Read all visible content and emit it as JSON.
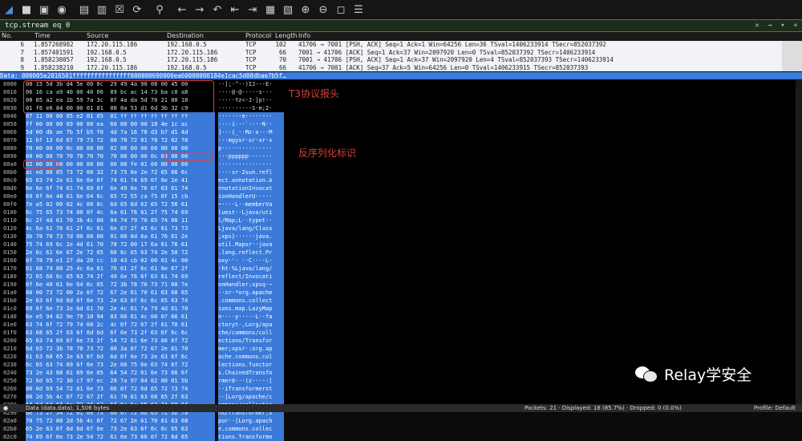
{
  "toolbar": {
    "icons": [
      "shark-fin-icon",
      "stop-icon",
      "restart-icon",
      "options-gear-icon",
      "open-file-icon",
      "save-file-icon",
      "close-file-icon",
      "reload-icon",
      "search-icon",
      "back-arrow-icon",
      "forward-arrow-icon",
      "go-to-packet-icon",
      "first-packet-icon",
      "last-packet-icon",
      "autoscroll-icon",
      "colorize-icon",
      "zoom-in-icon",
      "zoom-out-icon",
      "normal-size-icon",
      "resize-columns-icon"
    ]
  },
  "filter": {
    "value": "tcp.stream eq 0"
  },
  "columns": [
    "No.",
    "Time",
    "Source",
    "Destination",
    "Protocol",
    "Length",
    "Info"
  ],
  "packets": [
    {
      "no": "6",
      "time": "1.857268982",
      "src": "172.20.115.186",
      "dst": "192.168.0.5",
      "proto": "TCP",
      "len": "102",
      "info": "41706 → 7001 [PSH, ACK] Seq=1 Ack=1 Win=64256 Len=36 TSval=1406233914 TSecr=852037392"
    },
    {
      "no": "7",
      "time": "1.857401591",
      "src": "192.168.0.5",
      "dst": "172.20.115.186",
      "proto": "TCP",
      "len": "66",
      "info": "7001 → 41706 [ACK] Seq=1 Ack=37 Win=2097920 Len=0 TSval=852037392 TSecr=1406233914"
    },
    {
      "no": "8",
      "time": "1.858230057",
      "src": "192.168.0.5",
      "dst": "172.20.115.186",
      "proto": "TCP",
      "len": "70",
      "info": "7001 → 41706 [PSH, ACK] Seq=1 Ack=37 Win=2097920 Len=4 TSval=852037393 TSecr=1406233914"
    },
    {
      "no": "9",
      "time": "1.858238210",
      "src": "172.20.115.186",
      "dst": "192.168.0.5",
      "proto": "TCP",
      "len": "66",
      "info": "41706 → 7001 [ACK] Seq=37 Ack=5 Win=64256 Len=0 TSval=1406233915 TSecr=852037393"
    }
  ],
  "data_bar": "Data: 000005e2016501ffffffffffffffff000000690000ea60000000184e1cac5d00dbae7b5f…",
  "annotations": {
    "t3_header": "T3协议报头",
    "deserialize_marker": "反序列化标识"
  },
  "hex_rows": [
    {
      "o": "0000",
      "h": "00 15 5d 3b d4 5e 00 0c  29 49 4a 90 08 00 45 00",
      "a": "··];·^··)IJ···E·",
      "s": false
    },
    {
      "o": "0010",
      "h": "06 16 ca a9 40 00 40 06  89 bc ac 14 73 ba c0 a8",
      "a": "····@·@·····s···",
      "s": false
    },
    {
      "o": "0020",
      "h": "00 05 a2 ea 1b 59 7a 3c  8f 4a da 5d 70 21 80 18",
      "a": "·····Yz<·J·]p!··",
      "s": false
    },
    {
      "o": "0030",
      "h": "01 f6 e6 84 00 00 01 01  08 0a 53 d1 6d 3b 32 c9",
      "a": "··········S·m;2·",
      "s": false
    },
    {
      "o": "0040",
      "h": "07 11 00 00 05 e2 01 65  01 ff ff ff ff ff ff ff",
      "a": "·······e········",
      "s": true
    },
    {
      "o": "0050",
      "h": "ff 00 00 00 69 00 00 ea  60 00 00 00 18 4e 1c ac",
      "a": "····i···`····N··",
      "s": true
    },
    {
      "o": "0060",
      "h": "5d 00 db ae 7b 5f b5 f0  4d 7a 16 78 d3 b7 d1 4d",
      "a": "]···{_··Mz·x···M",
      "s": true
    },
    {
      "o": "0070",
      "h": "11 bf 13 6d 67 79 73 72  00 78 72 01 78 72 02 78",
      "a": "···mgysr·xr·xr·x",
      "s": true
    },
    {
      "o": "0080",
      "h": "70 00 00 00 0c 00 00 00  02 00 00 00 00 00 00 00",
      "a": "p···············",
      "s": true
    },
    {
      "o": "0090",
      "h": "00 00 00 70 70 70 70 70  70 00 00 00 0c 00 00 00",
      "a": "···pppppp·······",
      "s": true
    },
    {
      "o": "00a0",
      "h": "02 00 00 00 00 00 00 00  06 00 fe 01 00 00 00 00",
      "a": "················",
      "s": true
    },
    {
      "o": "00b0",
      "h": "ac ed 00 05 73 72 00 32  73 75 6e 2e 72 65 66 6c",
      "a": "····sr·2sun.refl",
      "s": true
    },
    {
      "o": "00c0",
      "h": "65 63 74 2e 61 6e 6e 6f  74 61 74 69 6f 6e 2e 41",
      "a": "ect.annotation.A",
      "s": true
    },
    {
      "o": "00d0",
      "h": "6e 6e 6f 74 61 74 69 6f  6e 49 6e 76 6f 63 61 74",
      "a": "nnotationInvocat",
      "s": true
    },
    {
      "o": "00e0",
      "h": "69 6f 6e 48 61 6e 64 6c  65 72 55 ca f5 0f 15 cb",
      "a": "ionHandlerU·····",
      "s": true
    },
    {
      "o": "00f0",
      "h": "7e a5 02 00 02 4c 00 0c  6d 65 6d 62 65 72 56 61",
      "a": "~····L··memberVa",
      "s": true
    },
    {
      "o": "0100",
      "h": "6c 75 65 73 74 00 0f 4c  6a 61 76 61 2f 75 74 69",
      "a": "luest··Ljava/uti",
      "s": true
    },
    {
      "o": "0110",
      "h": "6c 2f 4d 61 70 3b 4c 00  04 74 79 70 65 74 00 11",
      "a": "l/Map;L··typet··",
      "s": true
    },
    {
      "o": "0120",
      "h": "4c 6a 61 76 61 2f 6c 61  6e 67 2f 43 6c 61 73 73",
      "a": "Ljava/lang/Class",
      "s": true
    },
    {
      "o": "0130",
      "h": "3b 78 70 73 7d 00 00 00  01 00 0d 6a 61 76 61 2e",
      "a": ";xps}······java.",
      "s": true
    },
    {
      "o": "0140",
      "h": "75 74 69 6c 2e 4d 61 70  78 72 00 17 6a 61 76 61",
      "a": "util.Mapxr··java",
      "s": true
    },
    {
      "o": "0150",
      "h": "2e 6c 61 6e 67 2e 72 65  66 6c 65 63 74 2e 50 72",
      "a": ".lang.reflect.Pr",
      "s": true
    },
    {
      "o": "0160",
      "h": "6f 78 79 e1 27 da 20 cc  10 43 cb 02 00 01 4c 00",
      "a": "oxy·'· ··C····L·",
      "s": true
    },
    {
      "o": "0170",
      "h": "01 68 74 00 25 4c 6a 61  76 61 2f 6c 61 6e 67 2f",
      "a": "·ht·%Ljava/lang/",
      "s": true
    },
    {
      "o": "0180",
      "h": "72 65 66 6c 65 63 74 2f  49 6e 76 6f 63 61 74 69",
      "a": "reflect/Invocati",
      "s": true
    },
    {
      "o": "0190",
      "h": "6f 6e 48 61 6e 64 6c 65  72 3b 78 70 73 71 00 7e",
      "a": "onHandler;xpsq·~",
      "s": true
    },
    {
      "o": "01a0",
      "h": "00 00 73 72 00 2a 6f 72  67 2e 61 70 61 63 68 65",
      "a": "··sr·*org.apache",
      "s": true
    },
    {
      "o": "01b0",
      "h": "2e 63 6f 6d 6d 6f 6e 73  2e 63 6f 6c 6c 65 63 74",
      "a": ".commons.collect",
      "s": true
    },
    {
      "o": "01c0",
      "h": "69 6f 6e 73 2e 6d 61 70  2e 4c 61 7a 79 4d 61 70",
      "a": "ions.map.LazyMap",
      "s": true
    },
    {
      "o": "01d0",
      "h": "6e e5 94 82 9e 79 10 94  03 00 01 4c 00 07 66 61",
      "a": "n····y·····L··fa",
      "s": true
    },
    {
      "o": "01e0",
      "h": "63 74 6f 72 79 74 00 2c  4c 6f 72 67 2f 61 70 61",
      "a": "ctoryt·,Lorg/apa",
      "s": true
    },
    {
      "o": "01f0",
      "h": "63 68 65 2f 63 6f 6d 6d  6f 6e 73 2f 63 6f 6c 6c",
      "a": "che/commons/coll",
      "s": true
    },
    {
      "o": "0200",
      "h": "65 63 74 69 6f 6e 73 2f  54 72 61 6e 73 66 6f 72",
      "a": "ections/Transfor",
      "s": true
    },
    {
      "o": "0210",
      "h": "6d 65 72 3b 78 70 73 72  00 3a 6f 72 67 2e 61 70",
      "a": "mer;xpsr·:org.ap",
      "s": true
    },
    {
      "o": "0220",
      "h": "61 63 68 65 2e 63 6f 6d  6d 6f 6e 73 2e 63 6f 6c",
      "a": "ache.commons.col",
      "s": true
    },
    {
      "o": "0230",
      "h": "6c 65 63 74 69 6f 6e 73  2e 66 75 6e 63 74 6f 72",
      "a": "lections.functor",
      "s": true
    },
    {
      "o": "0240",
      "h": "73 2e 43 68 61 69 6e 65  64 54 72 61 6e 73 66 6f",
      "a": "s.ChainedTransfo",
      "s": true
    },
    {
      "o": "0250",
      "h": "72 6d 65 72 30 c7 97 ec  28 7a 97 04 02 00 01 5b",
      "a": "rmer0···(z·····[",
      "s": true
    },
    {
      "o": "0260",
      "h": "00 0d 69 54 72 61 6e 73  66 6f 72 6d 65 72 73 74",
      "a": "··iTransformerst",
      "s": true
    },
    {
      "o": "0270",
      "h": "00 2d 5b 4c 6f 72 67 2f  61 70 61 63 68 65 2f 63",
      "a": "·-[Lorg/apache/c",
      "s": true
    },
    {
      "o": "0280",
      "h": "6f 6d 6d 6f 6e 73 2f 63  6f 6c 6c 65 63 74 69 6f",
      "a": "ommons/collectio",
      "s": true
    },
    {
      "o": "0290",
      "h": "6e 73 2f 54 72 61 6e 73  66 6f 72 6d 65 72 3b 78",
      "a": "ns/Transformer;x",
      "s": true
    },
    {
      "o": "02a0",
      "h": "70 75 72 00 2d 5b 4c 6f  72 67 2e 61 70 61 63 68",
      "a": "pur·-[Lorg.apach",
      "s": true
    },
    {
      "o": "02b0",
      "h": "65 2e 63 6f 6d 6d 6f 6e  73 2e 63 6f 6c 6c 65 63",
      "a": "e.commons.collec",
      "s": true
    },
    {
      "o": "02c0",
      "h": "74 69 6f 6e 73 2e 54 72  61 6e 73 66 6f 72 6d 65",
      "a": "tions.Transforme",
      "s": true
    }
  ],
  "watermark": {
    "text": "Relay学安全"
  },
  "status": {
    "left": "Data (data.data), 1,506 bytes",
    "right": "Packets: 21 · Displayed: 18 (85.7%) · Dropped: 0 (0.0%)",
    "profile": "Profile: Default"
  }
}
